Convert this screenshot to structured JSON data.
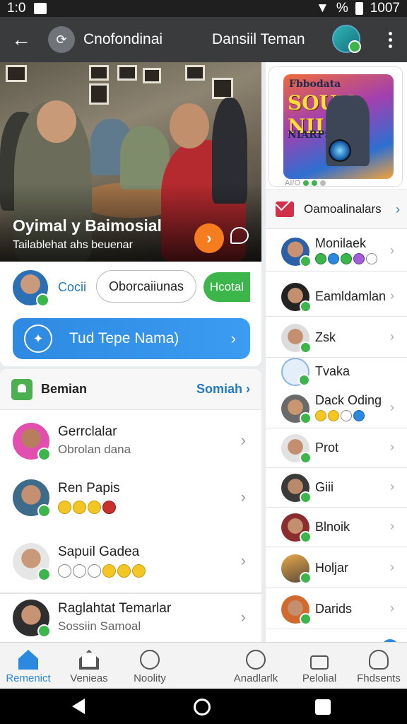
{
  "status_bar": {
    "time": "1:0",
    "battery_text": "%",
    "clock": "1007"
  },
  "app_bar": {
    "title": "Cnofondinai",
    "user_name": "Dansiil Teman"
  },
  "hero": {
    "title": "Oyimal y Baimosial",
    "subtitle": "Tailablehat ahs beuenar"
  },
  "actions": {
    "pill_label": "Cocii",
    "outline_button": "Oborcaiiunas",
    "green_button": "Hcotal",
    "cta_label": "Tud Tepe Nama)"
  },
  "contacts": {
    "header_title": "Bemian",
    "header_link": "Somiah",
    "items": [
      {
        "name": "Gerrclalar",
        "subtitle": "Obrolan dana"
      },
      {
        "name": "Ren Papis",
        "subtitle": ""
      },
      {
        "name": "Sapuil Gadea",
        "subtitle": ""
      },
      {
        "name": "Raglahtat Temarlar",
        "subtitle": "Sossiin Samoal"
      }
    ]
  },
  "promo": {
    "line1": "Fbbodata",
    "line2": "SOUN NII",
    "line3": "NIARPS",
    "caption": "AI/O"
  },
  "right_list": {
    "header": "Oamoalinalars",
    "items": [
      "Monilaek",
      "Eamldamlan",
      "Zsk",
      "Tvaka",
      "Dack Oding",
      "Prot",
      "Giii",
      "Blnoik",
      "Holjar",
      "Darids"
    ]
  },
  "tabs": [
    "Remenict",
    "Venieas",
    "Noolity",
    "Anadlarlk",
    "Pelolial",
    "Fhdsents"
  ],
  "colors": {
    "accent": "#2b8ae0",
    "online": "#3cb54a",
    "orange": "#f57c1f",
    "app_bar": "#3a3b3d"
  },
  "icons": {
    "status": [
      "signal-icon",
      "image-icon",
      "wifi-icon",
      "battery-icon"
    ],
    "tabs": [
      "home-icon",
      "house-icon",
      "compass-icon",
      "clock-icon",
      "lock-icon",
      "person-icon"
    ]
  }
}
